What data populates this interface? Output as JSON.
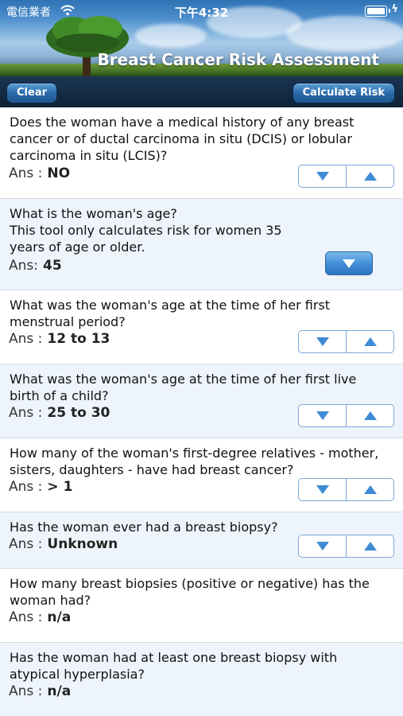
{
  "status_bar": {
    "carrier": "電信業者",
    "time": "下午4:32"
  },
  "header": {
    "title": "Breast Cancer Risk Assessment",
    "clear_label": "Clear",
    "calculate_label": "Calculate Risk"
  },
  "answer_label": "Ans :",
  "answer_label_compact": "Ans:",
  "questions": [
    {
      "text": "Does the woman have a medical history of any breast cancer or of ductal carcinoma in situ (DCIS) or lobular carcinoma in situ (LCIS)?",
      "answer": "NO"
    },
    {
      "text": "What is the woman's age?\nThis tool only calculates risk for women 35 years of age or older.",
      "answer": "45"
    },
    {
      "text": "What was the woman's age at the time of her first menstrual period?",
      "answer": "12 to 13"
    },
    {
      "text": "What was the woman's age at the time of her first live birth of a child?",
      "answer": "25 to 30"
    },
    {
      "text": "How many of the woman's first-degree relatives - mother, sisters, daughters - have had breast cancer?",
      "answer": "> 1"
    },
    {
      "text": "Has the woman ever had a breast biopsy?",
      "answer": "Unknown"
    },
    {
      "text": "How many breast biopsies (positive or negative) has the woman had?",
      "answer": "n/a"
    },
    {
      "text": "Has the woman had at least one breast biopsy with atypical hyperplasia?",
      "answer": "n/a"
    }
  ],
  "colors": {
    "accent": "#3f8bd6",
    "row_alt": "#eef4fb",
    "header_dark": "#11243a"
  },
  "icons": {
    "wifi": "wifi-icon",
    "battery": "battery-icon",
    "down": "triangle-down-icon",
    "up": "triangle-up-icon"
  }
}
